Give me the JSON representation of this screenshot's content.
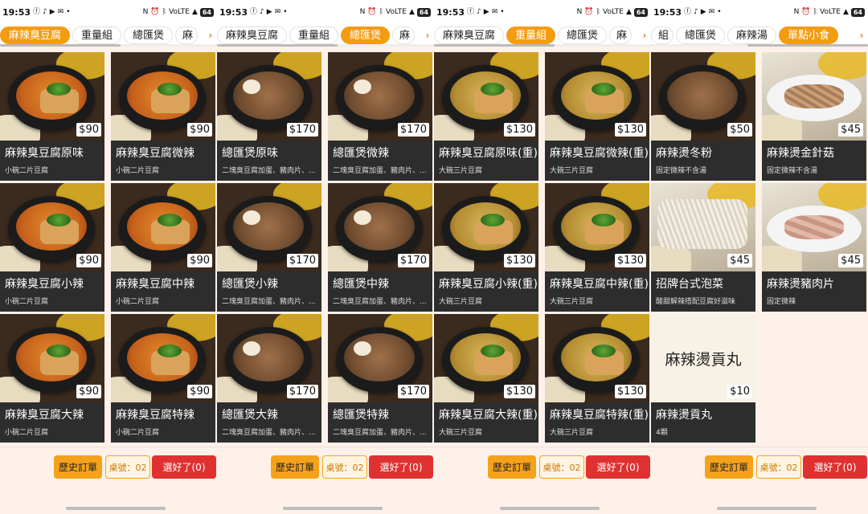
{
  "status_bar": {
    "time": "19:53",
    "battery": "64"
  },
  "icons": {
    "status_left": [
      "facebook-icon",
      "tiktok-icon",
      "youtube-icon",
      "mail-icon",
      "dot-icon"
    ],
    "status_right": [
      "nfc-icon",
      "alarm-icon",
      "bluetooth-icon",
      "volte-icon",
      "signal-icon",
      "battery-icon"
    ],
    "tab_scroll": "chevron-right-icon"
  },
  "colors": {
    "accent": "#f39c12",
    "done_button": "#e03131",
    "card_bg": "#2d2d2d"
  },
  "panels": [
    {
      "tabs": [
        {
          "label": "麻辣臭豆腐",
          "active": true
        },
        {
          "label": "重量組",
          "active": false
        },
        {
          "label": "總匯煲",
          "active": false
        },
        {
          "label": "麻",
          "active": false,
          "cut": true
        }
      ],
      "items": [
        {
          "name": "麻辣臭豆腐原味",
          "desc": "小碗二片豆腐",
          "price": "$90",
          "img": "tofu-red"
        },
        {
          "name": "麻辣臭豆腐微辣",
          "desc": "小碗二片豆腐",
          "price": "$90",
          "img": "tofu-red"
        },
        {
          "name": "麻辣臭豆腐小辣",
          "desc": "小碗二片豆腐",
          "price": "$90",
          "img": "tofu-red"
        },
        {
          "name": "麻辣臭豆腐中辣",
          "desc": "小碗二片豆腐",
          "price": "$90",
          "img": "tofu-red"
        },
        {
          "name": "麻辣臭豆腐大辣",
          "desc": "小碗二片豆腐",
          "price": "$90",
          "img": "tofu-red"
        },
        {
          "name": "麻辣臭豆腐特辣",
          "desc": "小碗二片豆腐",
          "price": "$90",
          "img": "tofu-red"
        }
      ],
      "bottom": {
        "history": "歷史訂單",
        "table": "桌號：02",
        "done": "選好了(0)"
      }
    },
    {
      "tabs": [
        {
          "label": "麻辣臭豆腐",
          "active": false
        },
        {
          "label": "重量組",
          "active": false
        },
        {
          "label": "總匯煲",
          "active": true
        },
        {
          "label": "麻",
          "active": false,
          "cut": true
        }
      ],
      "items": [
        {
          "name": "總匯煲原味",
          "desc": "二塊臭豆腐加蛋、豬肉片、...",
          "price": "$170",
          "img": "pot"
        },
        {
          "name": "總匯煲微辣",
          "desc": "二塊臭豆腐加蛋、豬肉片、...",
          "price": "$170",
          "img": "pot"
        },
        {
          "name": "總匯煲小辣",
          "desc": "二塊臭豆腐加蛋、豬肉片、...",
          "price": "$170",
          "img": "pot"
        },
        {
          "name": "總匯煲中辣",
          "desc": "二塊臭豆腐加蛋、豬肉片、...",
          "price": "$170",
          "img": "pot"
        },
        {
          "name": "總匯煲大辣",
          "desc": "二塊臭豆腐加蛋、豬肉片、...",
          "price": "$170",
          "img": "pot"
        },
        {
          "name": "總匯煲特辣",
          "desc": "二塊臭豆腐加蛋、豬肉片、...",
          "price": "$170",
          "img": "pot"
        }
      ],
      "bottom": {
        "history": "歷史訂單",
        "table": "桌號：02",
        "done": "選好了(0)"
      }
    },
    {
      "tabs": [
        {
          "label": "麻辣臭豆腐",
          "active": false
        },
        {
          "label": "重量組",
          "active": true
        },
        {
          "label": "總匯煲",
          "active": false
        },
        {
          "label": "麻",
          "active": false,
          "cut": true
        }
      ],
      "items": [
        {
          "name": "麻辣臭豆腐原味(重)",
          "desc": "大碗三片豆腐",
          "price": "$130",
          "img": "tofu-yellow"
        },
        {
          "name": "麻辣臭豆腐微辣(重)",
          "desc": "大碗三片豆腐",
          "price": "$130",
          "img": "tofu-yellow"
        },
        {
          "name": "麻辣臭豆腐小辣(重)",
          "desc": "大碗三片豆腐",
          "price": "$130",
          "img": "tofu-yellow"
        },
        {
          "name": "麻辣臭豆腐中辣(重)",
          "desc": "大碗三片豆腐",
          "price": "$130",
          "img": "tofu-yellow"
        },
        {
          "name": "麻辣臭豆腐大辣(重)",
          "desc": "大碗三片豆腐",
          "price": "$130",
          "img": "tofu-yellow"
        },
        {
          "name": "麻辣臭豆腐特辣(重)",
          "desc": "大碗三片豆腐",
          "price": "$130",
          "img": "tofu-yellow"
        }
      ],
      "bottom": {
        "history": "歷史訂單",
        "table": "桌號：02",
        "done": "選好了(0)"
      }
    },
    {
      "tabs": [
        {
          "label": "組",
          "active": false,
          "cut": true
        },
        {
          "label": "總匯煲",
          "active": false
        },
        {
          "label": "麻辣湯",
          "active": false
        },
        {
          "label": "單點小食",
          "active": true
        }
      ],
      "items": [
        {
          "name": "麻辣燙冬粉",
          "desc": "固定微辣不含湯",
          "price": "$50",
          "img": "vermicelli"
        },
        {
          "name": "麻辣燙金針菇",
          "desc": "固定微辣不含湯",
          "price": "$45",
          "img": "mushroom"
        },
        {
          "name": "招牌台式泡菜",
          "desc": "酸甜解辣搭配豆腐好滋味",
          "price": "$45",
          "img": "kimchi"
        },
        {
          "name": "麻辣燙豬肉片",
          "desc": "固定微辣",
          "price": "$45",
          "img": "pork"
        },
        {
          "name": "麻辣燙貢丸",
          "desc": "4顆",
          "price": "$10",
          "img": "text",
          "img_text": "麻辣燙貢丸"
        }
      ],
      "bottom": {
        "history": "歷史訂單",
        "table": "桌號：02",
        "done": "選好了(0)"
      }
    }
  ]
}
